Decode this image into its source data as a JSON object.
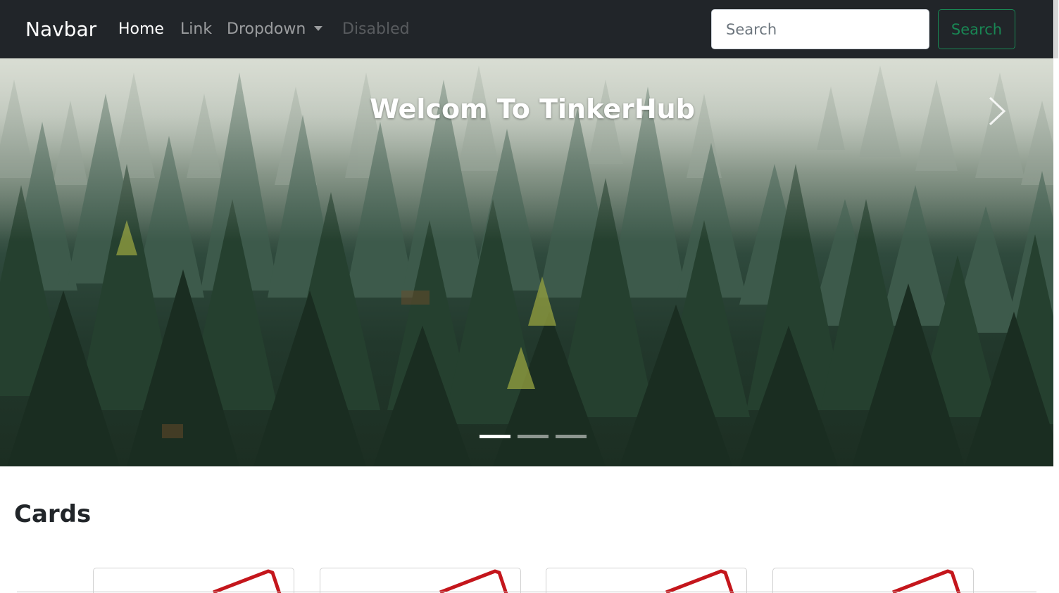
{
  "navbar": {
    "brand": "Navbar",
    "links": [
      {
        "label": "Home",
        "state": "active"
      },
      {
        "label": "Link",
        "state": "normal"
      },
      {
        "label": "Dropdown",
        "state": "dropdown"
      },
      {
        "label": "Disabled",
        "state": "disabled"
      }
    ],
    "search": {
      "placeholder": "Search",
      "value": ""
    },
    "search_button": "Search"
  },
  "carousel": {
    "caption": "Welcom To TinkerHub",
    "slide_count": 3,
    "active_slide": 1
  },
  "cards_section": {
    "title": "Cards",
    "card_count": 4
  },
  "colors": {
    "navbar_bg": "#212529",
    "success": "#198754",
    "card_image_stroke": "#c4161c"
  },
  "icons": [
    "chevron-right-icon",
    "caret-down-icon"
  ]
}
